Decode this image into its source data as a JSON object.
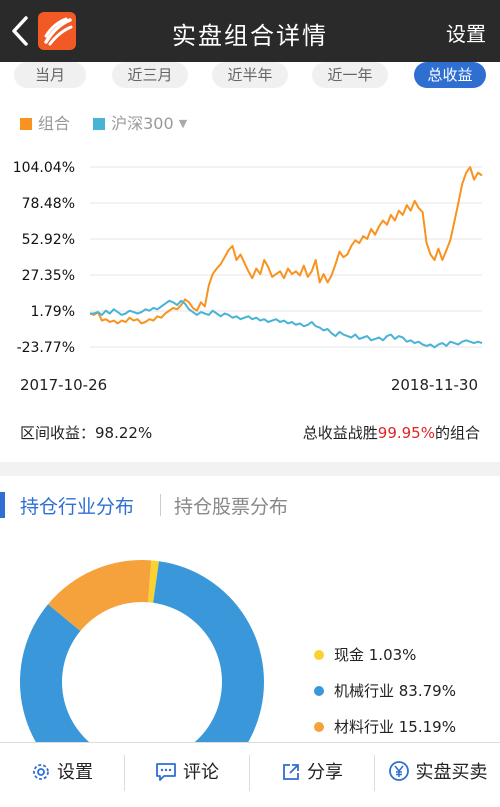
{
  "header": {
    "title": "实盘组合详情",
    "settings_label": "设置"
  },
  "tabs": [
    {
      "label": "当月",
      "active": false
    },
    {
      "label": "近三月",
      "active": false
    },
    {
      "label": "近半年",
      "active": false
    },
    {
      "label": "近一年",
      "active": false
    },
    {
      "label": "总收益",
      "active": true
    }
  ],
  "legend": {
    "portfolio": {
      "label": "组合",
      "color": "#f7931e"
    },
    "index": {
      "label": "沪深300",
      "color": "#49b3d6"
    }
  },
  "chart_data": {
    "type": "line",
    "y_ticks": [
      "104.04%",
      "78.48%",
      "52.92%",
      "27.35%",
      "1.79%",
      "-23.77%"
    ],
    "ylim": [
      -23.77,
      104.04
    ],
    "x_start": "2017-10-26",
    "x_end": "2018-11-30",
    "series": [
      {
        "name": "组合",
        "color": "#f7931e",
        "values": [
          0,
          -1,
          1,
          -5,
          -4,
          -6,
          -5,
          -7,
          -5,
          -6,
          -3,
          -5,
          -4,
          -7,
          -6,
          -4,
          -5,
          -2,
          -3,
          0,
          2,
          4,
          3,
          6,
          10,
          8,
          4,
          2,
          8,
          5,
          20,
          28,
          32,
          35,
          40,
          45,
          48,
          38,
          42,
          36,
          30,
          25,
          32,
          28,
          38,
          33,
          26,
          28,
          30,
          25,
          32,
          28,
          30,
          27,
          34,
          26,
          30,
          38,
          22,
          28,
          22,
          27,
          35,
          44,
          40,
          42,
          48,
          52,
          50,
          55,
          53,
          60,
          56,
          62,
          66,
          63,
          70,
          66,
          73,
          70,
          77,
          73,
          80,
          75,
          72,
          50,
          42,
          38,
          46,
          38,
          45,
          52,
          65,
          78,
          92,
          100,
          104,
          95,
          100,
          98
        ]
      },
      {
        "name": "沪深300",
        "color": "#49b3d6",
        "values": [
          0,
          0,
          1,
          -1,
          2,
          0,
          3,
          1,
          -1,
          0,
          2,
          1,
          0,
          1,
          3,
          2,
          4,
          3,
          5,
          7,
          9,
          8,
          6,
          9,
          7,
          3,
          1,
          -1,
          1,
          0,
          -1,
          2,
          0,
          -2,
          0,
          -1,
          -3,
          -2,
          -4,
          -3,
          -2,
          -4,
          -3,
          -5,
          -4,
          -6,
          -5,
          -4,
          -6,
          -5,
          -7,
          -6,
          -8,
          -7,
          -9,
          -8,
          -6,
          -9,
          -10,
          -12,
          -11,
          -14,
          -16,
          -13,
          -15,
          -16,
          -17,
          -15,
          -18,
          -17,
          -16,
          -19,
          -18,
          -17,
          -19,
          -16,
          -15,
          -18,
          -16,
          -17,
          -20,
          -19,
          -21,
          -20,
          -22,
          -23,
          -22,
          -24,
          -22,
          -21,
          -23,
          -20,
          -21,
          -22,
          -20,
          -19,
          -20,
          -21,
          -20,
          -21
        ]
      }
    ],
    "xlabel": "",
    "ylabel": ""
  },
  "dates": {
    "start": "2017-10-26",
    "end": "2018-11-30"
  },
  "summary": {
    "range_label": "区间收益：",
    "range_value": "98.22%",
    "beat_prefix": "总收益战胜",
    "beat_value": "99.95%",
    "beat_suffix": "的组合"
  },
  "section_tabs": {
    "industry": "持仓行业分布",
    "stocks": "持仓股票分布"
  },
  "allocation": [
    {
      "label": "现金 1.03%",
      "value": 1.03,
      "color": "#f9d131"
    },
    {
      "label": "机械行业 83.79%",
      "value": 83.79,
      "color": "#3a97d9"
    },
    {
      "label": "材料行业 15.19%",
      "value": 15.19,
      "color": "#f6a23c"
    }
  ],
  "bottom": {
    "settings": "设置",
    "comment": "评论",
    "share": "分享",
    "trade": "实盘买卖"
  }
}
